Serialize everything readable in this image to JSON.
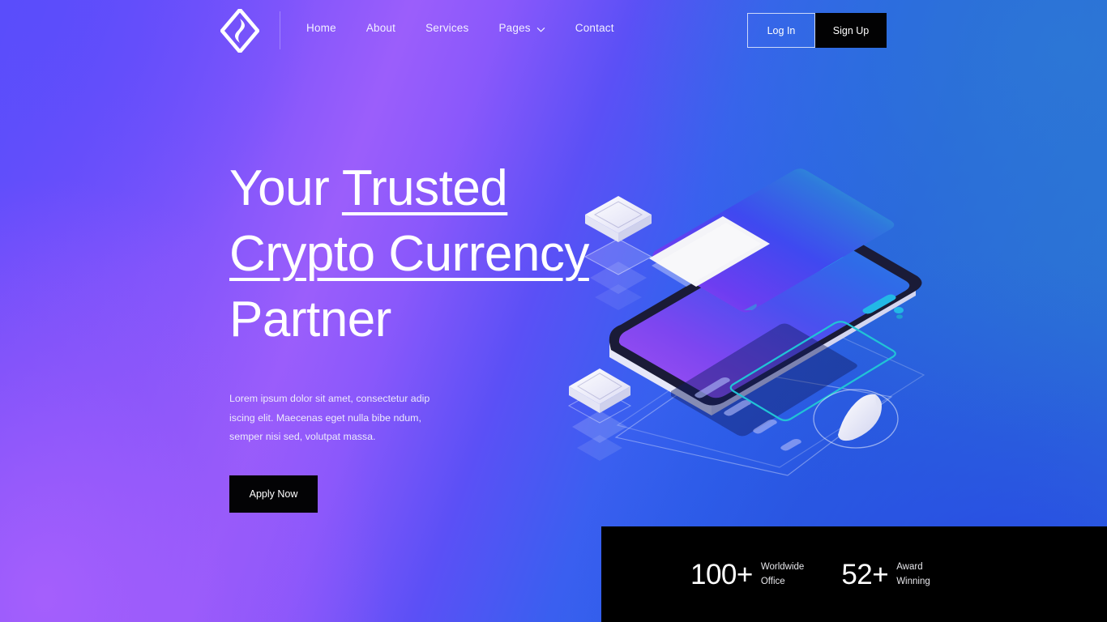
{
  "brand": {
    "logo_icon": "diamond-swirl-logo"
  },
  "nav": {
    "items": [
      {
        "label": "Home",
        "icon": null
      },
      {
        "label": "About",
        "icon": null
      },
      {
        "label": "Services",
        "icon": null
      },
      {
        "label": "Pages",
        "icon": "chevron-down-icon"
      },
      {
        "label": "Contact",
        "icon": null
      }
    ]
  },
  "auth": {
    "login_label": "Log In",
    "signup_label": "Sign Up"
  },
  "hero": {
    "title_line1_plain": "Your ",
    "title_line1_underlined": "Trusted",
    "title_line2_underlined": "Crypto Currency",
    "title_line3_plain": "Partner",
    "paragraph": "Lorem ipsum dolor sit amet, consectetur adip iscing elit. Maecenas eget nulla bibe ndum, semper nisi sed, volutpat massa.",
    "cta_label": "Apply Now"
  },
  "stats": [
    {
      "number": "100+",
      "label_line1": "Worldwide",
      "label_line2": "Office"
    },
    {
      "number": "52+",
      "label_line1": "Award",
      "label_line2": "Winning"
    }
  ],
  "illustration": {
    "name": "isometric-phone-credit-card",
    "elements": [
      "floating-rounded-square-top",
      "floating-rounded-square-bottom",
      "smartphone-isometric",
      "credit-card-isometric",
      "cursor-pointer-in-ellipse"
    ]
  },
  "colors": {
    "gradient_start": "#5a4dfb",
    "gradient_purple": "#9b5efb",
    "gradient_end": "#2b76d2",
    "dark_panel": "#000000",
    "text_on_dark": "#ffffff",
    "accent_cyan": "#22c2e8"
  }
}
